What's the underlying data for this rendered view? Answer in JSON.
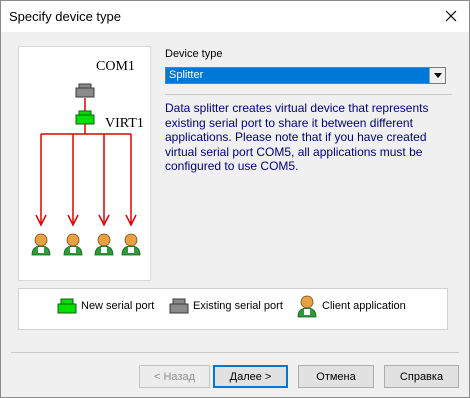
{
  "window": {
    "title": "Specify device type"
  },
  "diagram": {
    "port_label": "COM1",
    "virtual_label": "VIRT1",
    "client_count": 4
  },
  "device_type": {
    "label": "Device type",
    "value": "Splitter"
  },
  "description": "Data splitter creates virtual device that represents existing serial port to share it between different applications. Please note that if you have created virtual serial port COM5, all applications must be configured to use COM5.",
  "legend": {
    "new_port": "New serial port",
    "existing_port": "Existing serial port",
    "client_app": "Client application"
  },
  "buttons": {
    "back": "< Назад",
    "next": "Далее >",
    "cancel": "Отмена",
    "help": "Справка"
  },
  "colors": {
    "new_port": "#00e000",
    "existing_port": "#808080",
    "arrows": "#e00000",
    "description_text": "#000080",
    "selection": "#0078d7"
  },
  "icons": [
    "close-icon",
    "serial-port-icon",
    "client-icon",
    "chevron-down-icon",
    "arrow-down-icon"
  ]
}
